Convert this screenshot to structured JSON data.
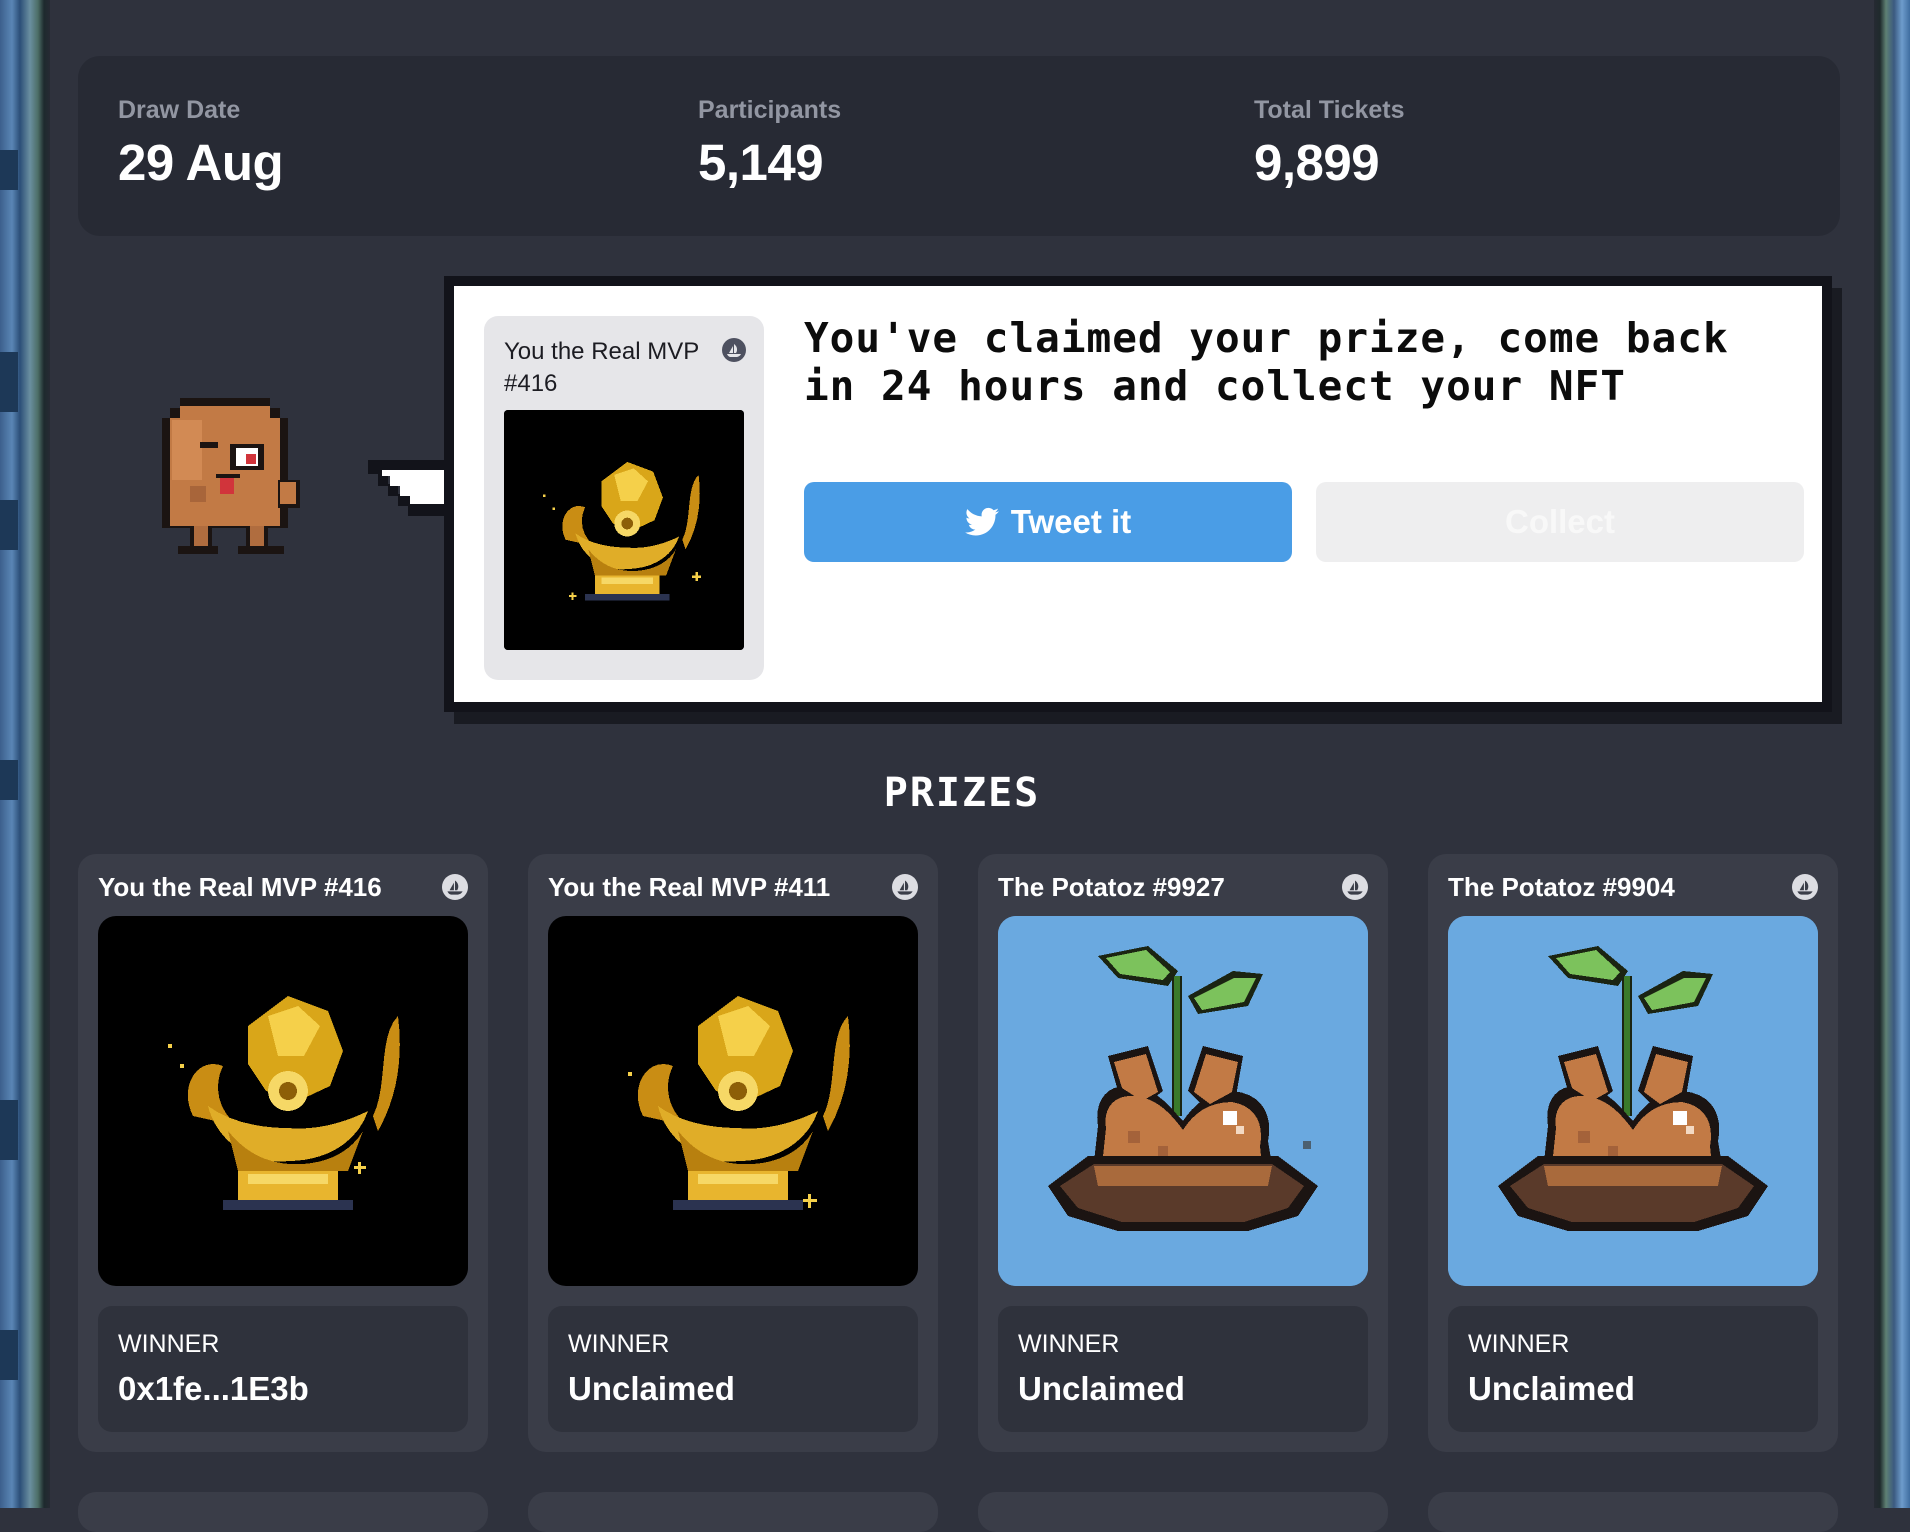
{
  "stats": [
    {
      "label": "Draw Date",
      "value": "29 Aug"
    },
    {
      "label": "Participants",
      "value": "5,149"
    },
    {
      "label": "Total Tickets",
      "value": "9,899"
    }
  ],
  "claim": {
    "nft_name": "You the Real MVP #416",
    "message": "You've claimed your prize, come back in 24 hours and collect your NFT",
    "tweet_label": "Tweet it",
    "collect_label": "Collect"
  },
  "prizes_title": "PRIZES",
  "prizes": [
    {
      "name": "You the Real MVP #416",
      "image": "golden-trophy",
      "winner_label": "WINNER",
      "winner": "0x1fe...1E3b"
    },
    {
      "name": "You the Real MVP #411",
      "image": "golden-trophy",
      "winner_label": "WINNER",
      "winner": "Unclaimed"
    },
    {
      "name": "The Potatoz #9927",
      "image": "potato-sprout",
      "winner_label": "WINNER",
      "winner": "Unclaimed"
    },
    {
      "name": "The Potatoz #9904",
      "image": "potato-sprout",
      "winner_label": "WINNER",
      "winner": "Unclaimed"
    }
  ],
  "colors": {
    "background": "#2f323d",
    "panel": "#272a34",
    "card": "#3a3d48",
    "tweet_button": "#4a9de6",
    "collect_button": "#eeeeef",
    "trophy_bg": "#000000",
    "potato_bg": "#6aa9e0"
  },
  "icons": {
    "marketplace": "opensea-boat-icon",
    "tweet": "twitter-bird-icon"
  }
}
